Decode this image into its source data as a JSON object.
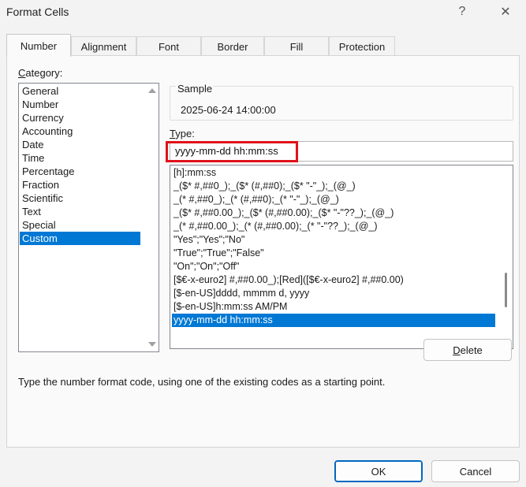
{
  "window": {
    "title": "Format Cells",
    "help_glyph": "?",
    "close_glyph": "✕"
  },
  "tabs": [
    {
      "label": "Number",
      "active": true
    },
    {
      "label": "Alignment",
      "active": false
    },
    {
      "label": "Font",
      "active": false
    },
    {
      "label": "Border",
      "active": false
    },
    {
      "label": "Fill",
      "active": false
    },
    {
      "label": "Protection",
      "active": false
    }
  ],
  "category": {
    "label_first": "C",
    "label_rest": "ategory:",
    "items": [
      "General",
      "Number",
      "Currency",
      "Accounting",
      "Date",
      "Time",
      "Percentage",
      "Fraction",
      "Scientific",
      "Text",
      "Special",
      "Custom"
    ],
    "selected": "Custom"
  },
  "sample": {
    "legend": "Sample",
    "value": "2025-06-24 14:00:00"
  },
  "type": {
    "label_first": "T",
    "label_rest": "ype:",
    "value": "yyyy-mm-dd hh:mm:ss"
  },
  "formats": {
    "items": [
      "[h]:mm:ss",
      "_($* #,##0_);_($* (#,##0);_($* \"-\"_);_(@_)",
      "_(* #,##0_);_(* (#,##0);_(* \"-\"_);_(@_)",
      "_($* #,##0.00_);_($* (#,##0.00);_($* \"-\"??_);_(@_)",
      "_(* #,##0.00_);_(* (#,##0.00);_(* \"-\"??_);_(@_)",
      "\"Yes\";\"Yes\";\"No\"",
      "\"True\";\"True\";\"False\"",
      "\"On\";\"On\";\"Off\"",
      "[$€-x-euro2] #,##0.00_);[Red]([$€-x-euro2] #,##0.00)",
      "[$-en-US]dddd, mmmm d, yyyy",
      "[$-en-US]h:mm:ss AM/PM",
      "yyyy-mm-dd hh:mm:ss"
    ],
    "selected": "yyyy-mm-dd hh:mm:ss"
  },
  "buttons": {
    "delete_first": "D",
    "delete_rest": "elete",
    "ok": "OK",
    "cancel": "Cancel"
  },
  "hint": "Type the number format code, using one of the existing codes as a starting point.",
  "colors": {
    "accent": "#0078d4",
    "highlight_box": "#e0111b"
  }
}
